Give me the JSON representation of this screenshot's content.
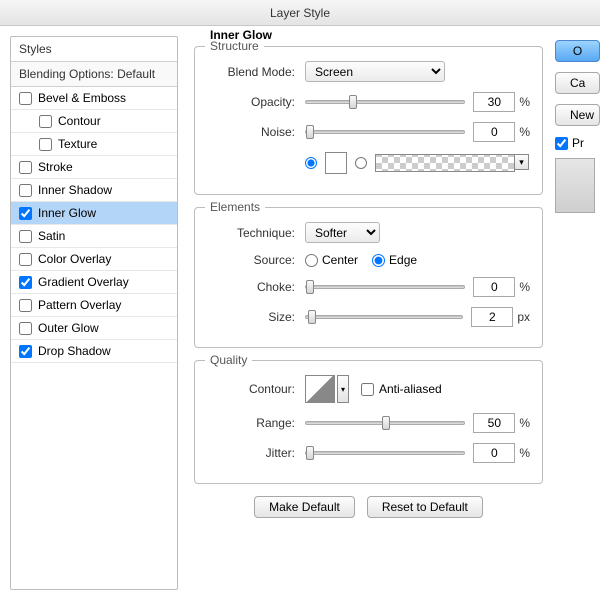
{
  "title": "Layer Style",
  "sidebar": {
    "header": "Styles",
    "subheader": "Blending Options: Default",
    "items": [
      {
        "label": "Bevel & Emboss",
        "checked": false,
        "indent": false
      },
      {
        "label": "Contour",
        "checked": false,
        "indent": true
      },
      {
        "label": "Texture",
        "checked": false,
        "indent": true
      },
      {
        "label": "Stroke",
        "checked": false,
        "indent": false
      },
      {
        "label": "Inner Shadow",
        "checked": false,
        "indent": false
      },
      {
        "label": "Inner Glow",
        "checked": true,
        "indent": false,
        "selected": true
      },
      {
        "label": "Satin",
        "checked": false,
        "indent": false
      },
      {
        "label": "Color Overlay",
        "checked": false,
        "indent": false
      },
      {
        "label": "Gradient Overlay",
        "checked": true,
        "indent": false
      },
      {
        "label": "Pattern Overlay",
        "checked": false,
        "indent": false
      },
      {
        "label": "Outer Glow",
        "checked": false,
        "indent": false
      },
      {
        "label": "Drop Shadow",
        "checked": true,
        "indent": false
      }
    ]
  },
  "panel": {
    "title": "Inner Glow",
    "structure": {
      "title": "Structure",
      "blend_label": "Blend Mode:",
      "blend_value": "Screen",
      "opacity_label": "Opacity:",
      "opacity_value": "30",
      "noise_label": "Noise:",
      "noise_value": "0",
      "percent": "%"
    },
    "elements": {
      "title": "Elements",
      "technique_label": "Technique:",
      "technique_value": "Softer",
      "source_label": "Source:",
      "source_center": "Center",
      "source_edge": "Edge",
      "choke_label": "Choke:",
      "choke_value": "0",
      "size_label": "Size:",
      "size_value": "2",
      "px": "px",
      "percent": "%"
    },
    "quality": {
      "title": "Quality",
      "contour_label": "Contour:",
      "aa_label": "Anti-aliased",
      "range_label": "Range:",
      "range_value": "50",
      "jitter_label": "Jitter:",
      "jitter_value": "0",
      "percent": "%"
    },
    "make_default": "Make Default",
    "reset_default": "Reset to Default"
  },
  "right": {
    "ok": "O",
    "cancel": "Ca",
    "new_style": "New",
    "preview_label": "Pr"
  }
}
